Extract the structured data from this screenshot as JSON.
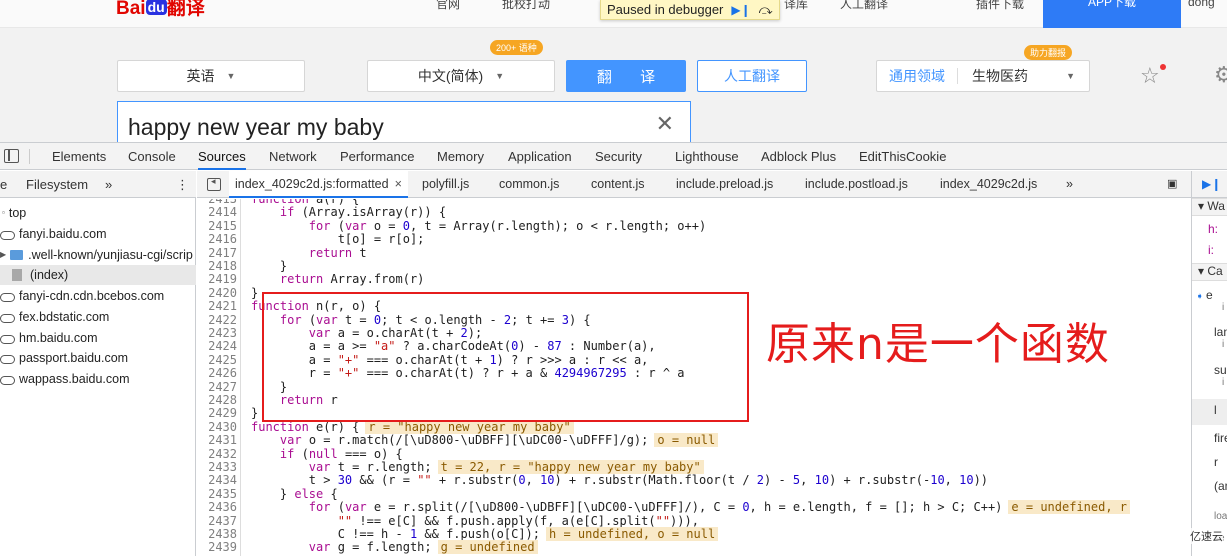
{
  "baidu": {
    "logo_main": "Bai",
    "logo_du": "du",
    "logo_suffix": "翻译",
    "nav": [
      "官网",
      "批校打动",
      "译库",
      "人工翻译",
      "插件下载"
    ],
    "app_download": "APP下载",
    "user": "dong",
    "debugger_banner": "Paused in debugger",
    "source_lang": "英语",
    "target_lang": "中文(简体)",
    "translate_btn": "翻 译",
    "human_btn": "人工翻译",
    "human_badge": "200+ 语种",
    "domain_badge": "助力翻报",
    "domain_label": "通用领域",
    "domain_value": "生物医药",
    "source_text": "happy new year my baby",
    "clear_icon": "close-icon"
  },
  "devtools": {
    "tabs": [
      "Elements",
      "Console",
      "Sources",
      "Network",
      "Performance",
      "Memory",
      "Application",
      "Security",
      "Lighthouse",
      "Adblock Plus",
      "EditThisCookie"
    ],
    "active_tab": "Sources",
    "nav_tabs": [
      "e",
      "Filesystem",
      "»"
    ],
    "tree": [
      {
        "label": "top",
        "type": "frame"
      },
      {
        "label": "fanyi.baidu.com",
        "type": "cloud"
      },
      {
        "label": ".well-known/yunjiasu-cgi/scrip",
        "type": "folder"
      },
      {
        "label": "(index)",
        "type": "file"
      },
      {
        "label": "fanyi-cdn.cdn.bcebos.com",
        "type": "cloud"
      },
      {
        "label": "fex.bdstatic.com",
        "type": "cloud"
      },
      {
        "label": "hm.baidu.com",
        "type": "cloud"
      },
      {
        "label": "passport.baidu.com",
        "type": "cloud"
      },
      {
        "label": "wappass.baidu.com",
        "type": "cloud"
      }
    ],
    "file_tabs": [
      "index_4029c2d.js:formatted",
      "polyfill.js",
      "common.js",
      "content.js",
      "include.preload.js",
      "include.postload.js",
      "index_4029c2d.js",
      "»"
    ],
    "line_numbers": [
      "2413",
      "2414",
      "2415",
      "2416",
      "2417",
      "2418",
      "2419",
      "2420",
      "2421",
      "2422",
      "2423",
      "2424",
      "2425",
      "2426",
      "2427",
      "2428",
      "2429",
      "2430",
      "2431",
      "2432",
      "2433",
      "2434",
      "2435",
      "2436",
      "2437",
      "2438",
      "2439"
    ],
    "code_lines": [
      "function a(r) {",
      "    if (Array.isArray(r)) {",
      "        for (var o = 0, t = Array(r.length); o < r.length; o++)",
      "            t[o] = r[o];",
      "        return t",
      "    }",
      "    return Array.from(r)",
      "}",
      "function n(r, o) {",
      "    for (var t = 0; t < o.length - 2; t += 3) {",
      "        var a = o.charAt(t + 2);",
      "        a = a >= \"a\" ? a.charCodeAt(0) - 87 : Number(a),",
      "        a = \"+\" === o.charAt(t + 1) ? r >>> a : r << a,",
      "        r = \"+\" === o.charAt(t) ? r + a & 4294967295 : r ^ a",
      "    }",
      "    return r",
      "}",
      "function e(r) {",
      "    var o = r.match(/[\\uD800-\\uDBFF][\\uDC00-\\uDFFF]/g);",
      "    if (null === o) {",
      "        var t = r.length;",
      "        t > 30 && (r = \"\" + r.substr(0, 10) + r.substr(Math.floor(t / 2) - 5, 10) + r.substr(-10, 10))",
      "    } else {",
      "        for (var e = r.split(/[\\uD800-\\uDBFF][\\uDC00-\\uDFFF]/), C = 0, h = e.length, f = []; h > C; C++)",
      "            \"\" !== e[C] && f.push.apply(f, a(e[C].split(\"\"))),",
      "            C !== h - 1 && f.push(o[C]);",
      "        var g = f.length;"
    ],
    "inline_values": {
      "l2430": "r = \"happy new year my baby\"",
      "l2431": "o = null",
      "l2433": "t = 22, r = \"happy new year my baby\"",
      "l2436": "e = undefined, r",
      "l2438": "h = undefined, o = null",
      "l2439": "g = undefined"
    },
    "annotation": "原来n是一个函数",
    "right_pane": {
      "watch": "Wa",
      "var_h": "h:",
      "var_i": "i:",
      "callstack": "Ca",
      "frames": [
        "e",
        "i",
        "lan",
        "i",
        "su",
        "i",
        "l",
        "fire",
        "r",
        "(an",
        "loa"
      ],
      "footer": "se"
    },
    "watermark": "亿速云"
  },
  "colors": {
    "accent": "#4395ff",
    "annotation_red": "#e51c1c",
    "devtools_active": "#1a73e8"
  }
}
